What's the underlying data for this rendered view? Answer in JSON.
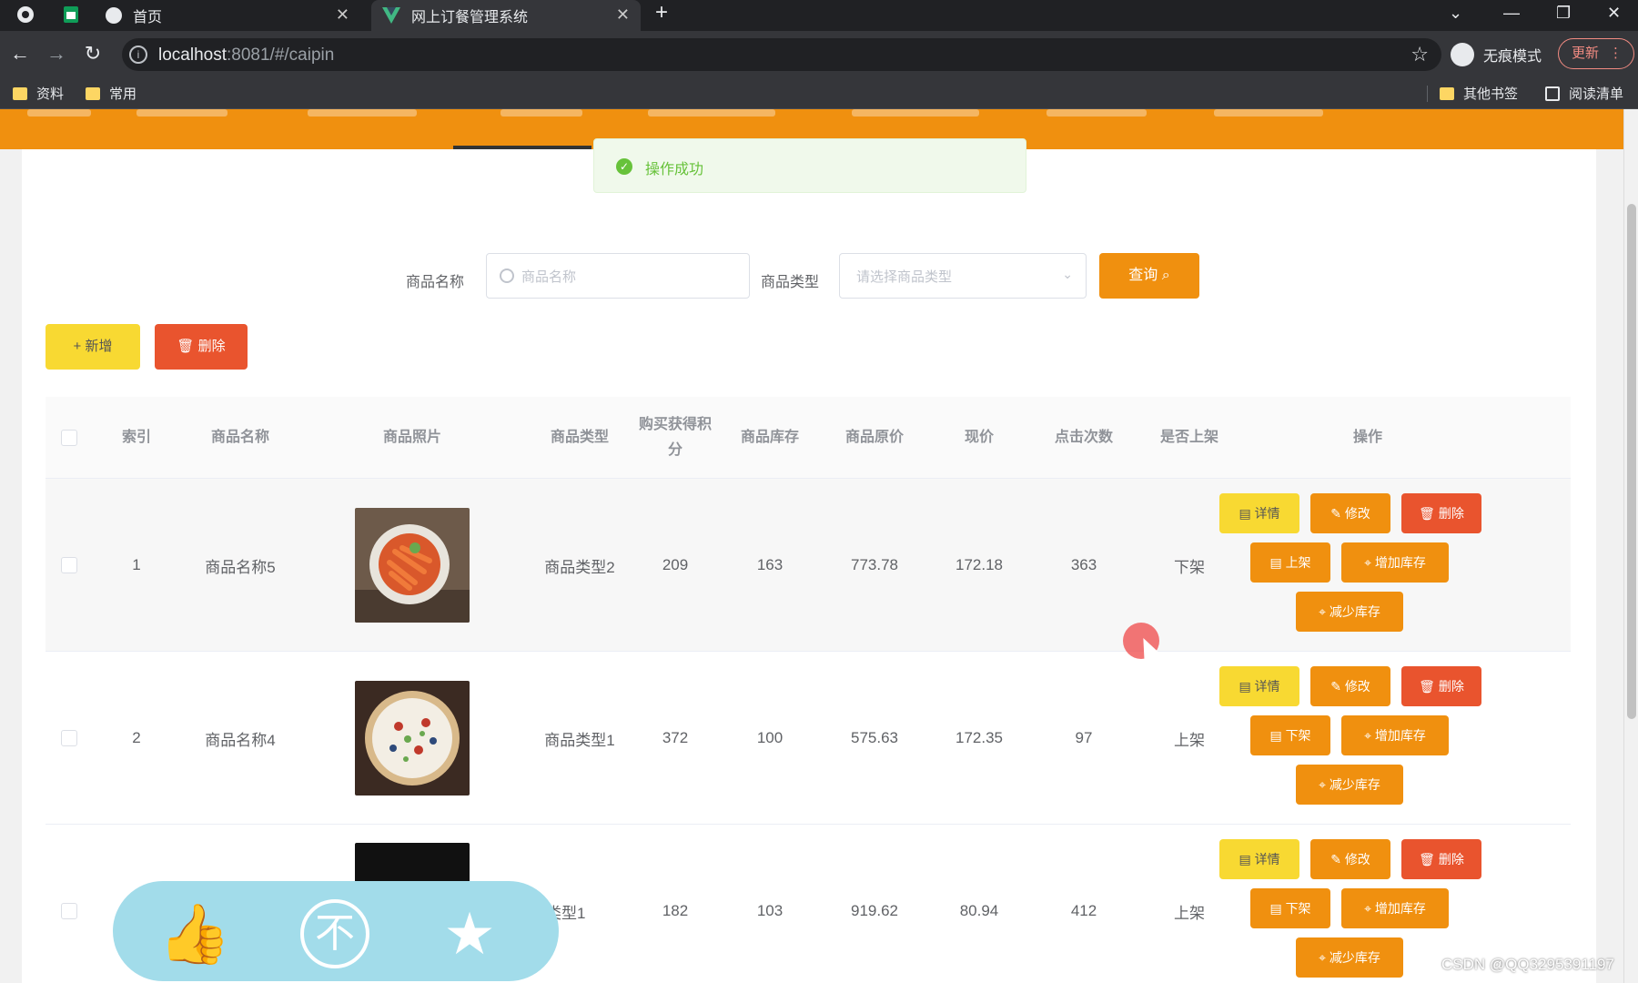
{
  "browser": {
    "tabs": [
      {
        "title": "首页"
      },
      {
        "title": "网上订餐管理系统"
      }
    ],
    "url_host": "localhost",
    "url_rest": ":8081/#/caipin",
    "incognito_label": "无痕模式",
    "update_label": "更新",
    "bookmarks": [
      "资料",
      "常用"
    ],
    "other_bookmarks": "其他书签",
    "reading_list": "阅读清单"
  },
  "toast": {
    "message": "操作成功"
  },
  "search": {
    "name_label": "商品名称",
    "name_placeholder": "商品名称",
    "type_label": "商品类型",
    "type_placeholder": "请选择商品类型",
    "query_label": "查询"
  },
  "toolbar": {
    "add_label": "+ 新增",
    "delete_label": "删除"
  },
  "table": {
    "headers": [
      "索引",
      "商品名称",
      "商品照片",
      "商品类型",
      "购买获得积分",
      "商品库存",
      "商品原价",
      "现价",
      "点击次数",
      "是否上架",
      "操作"
    ],
    "rows": [
      {
        "index": "1",
        "name": "商品名称5",
        "type": "商品类型2",
        "points": "209",
        "stock": "163",
        "orig_price": "773.78",
        "price": "172.18",
        "clicks": "363",
        "listed": "下架",
        "toggle_label": "上架"
      },
      {
        "index": "2",
        "name": "商品名称4",
        "type": "商品类型1",
        "points": "372",
        "stock": "100",
        "orig_price": "575.63",
        "price": "172.35",
        "clicks": "97",
        "listed": "上架",
        "toggle_label": "下架"
      },
      {
        "index": "",
        "name": "",
        "type": "类型1",
        "points": "182",
        "stock": "103",
        "orig_price": "919.62",
        "price": "80.94",
        "clicks": "412",
        "listed": "上架",
        "toggle_label": "下架"
      }
    ],
    "actions": {
      "detail": "详情",
      "edit": "修改",
      "delete": "删除",
      "add_stock": "增加库存",
      "reduce_stock": "减少库存"
    }
  },
  "watermark": "CSDN @QQ3295391197",
  "colors": {
    "nav": "#f0900f",
    "primary_button": "#f0900f",
    "yellow_button": "#f8d932",
    "danger_button": "#e9542e",
    "success": "#67c23a"
  }
}
